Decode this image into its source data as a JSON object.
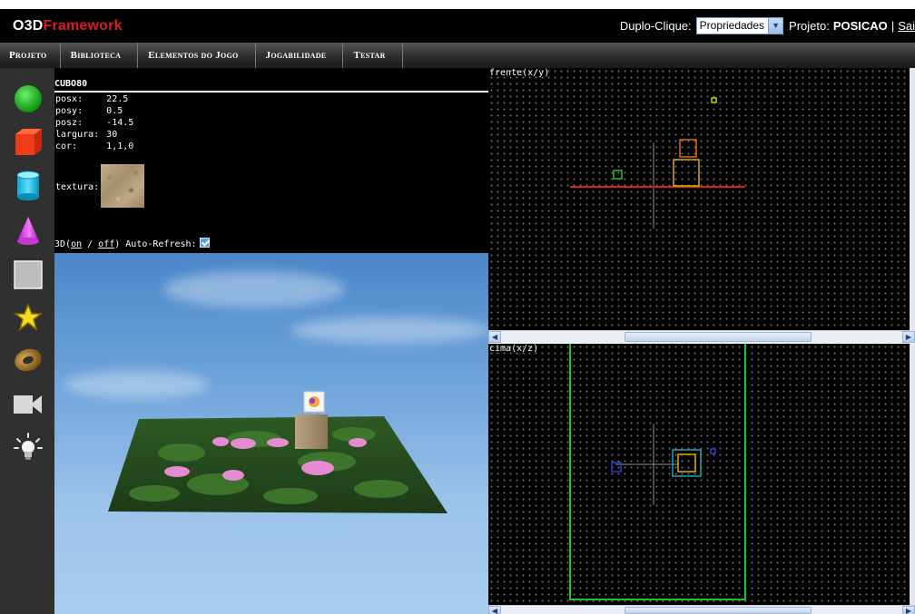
{
  "app": {
    "logo_main": "O3D",
    "logo_accent": "Framework",
    "brand_color": "#d81e1e"
  },
  "header": {
    "dblclick_label": "Duplo-Clique:",
    "dblclick_value": "Propriedades",
    "project_label": "Projeto:",
    "project_name": "POSICAO",
    "separator": "|",
    "exit_label": "Sai"
  },
  "menu": [
    "Projeto",
    "Biblioteca",
    "Elementos do Jogo",
    "Jogabilidade",
    "Testar"
  ],
  "tools": [
    {
      "name": "sphere-tool",
      "icon": "green-sphere-icon"
    },
    {
      "name": "cube-tool",
      "icon": "red-cube-icon"
    },
    {
      "name": "cylinder-tool",
      "icon": "cyan-cylinder-icon"
    },
    {
      "name": "cone-tool",
      "icon": "magenta-cone-icon"
    },
    {
      "name": "plane-tool",
      "icon": "gray-plane-icon"
    },
    {
      "name": "star-tool",
      "icon": "yellow-star-icon"
    },
    {
      "name": "torus-tool",
      "icon": "torus-icon"
    },
    {
      "name": "camera-tool",
      "icon": "camera-icon"
    },
    {
      "name": "light-tool",
      "icon": "light-bulb-icon"
    }
  ],
  "properties": {
    "object_name": "CUBO80",
    "fields": [
      {
        "key": "posx:",
        "value": "22.5"
      },
      {
        "key": "posy:",
        "value": "0.5"
      },
      {
        "key": "posz:",
        "value": "-14.5"
      },
      {
        "key": "largura:",
        "value": "30"
      },
      {
        "key": "cor:",
        "value": "1,1,0"
      }
    ],
    "texture_label": "textura:"
  },
  "view3d": {
    "prefix": "3D(",
    "on": "on",
    "slash": " / ",
    "off": "off",
    "suffix": ") Auto-Refresh:",
    "auto_refresh": true
  },
  "views": {
    "front_label": "frente(x/y)",
    "top_label": "cima(x/z)"
  }
}
